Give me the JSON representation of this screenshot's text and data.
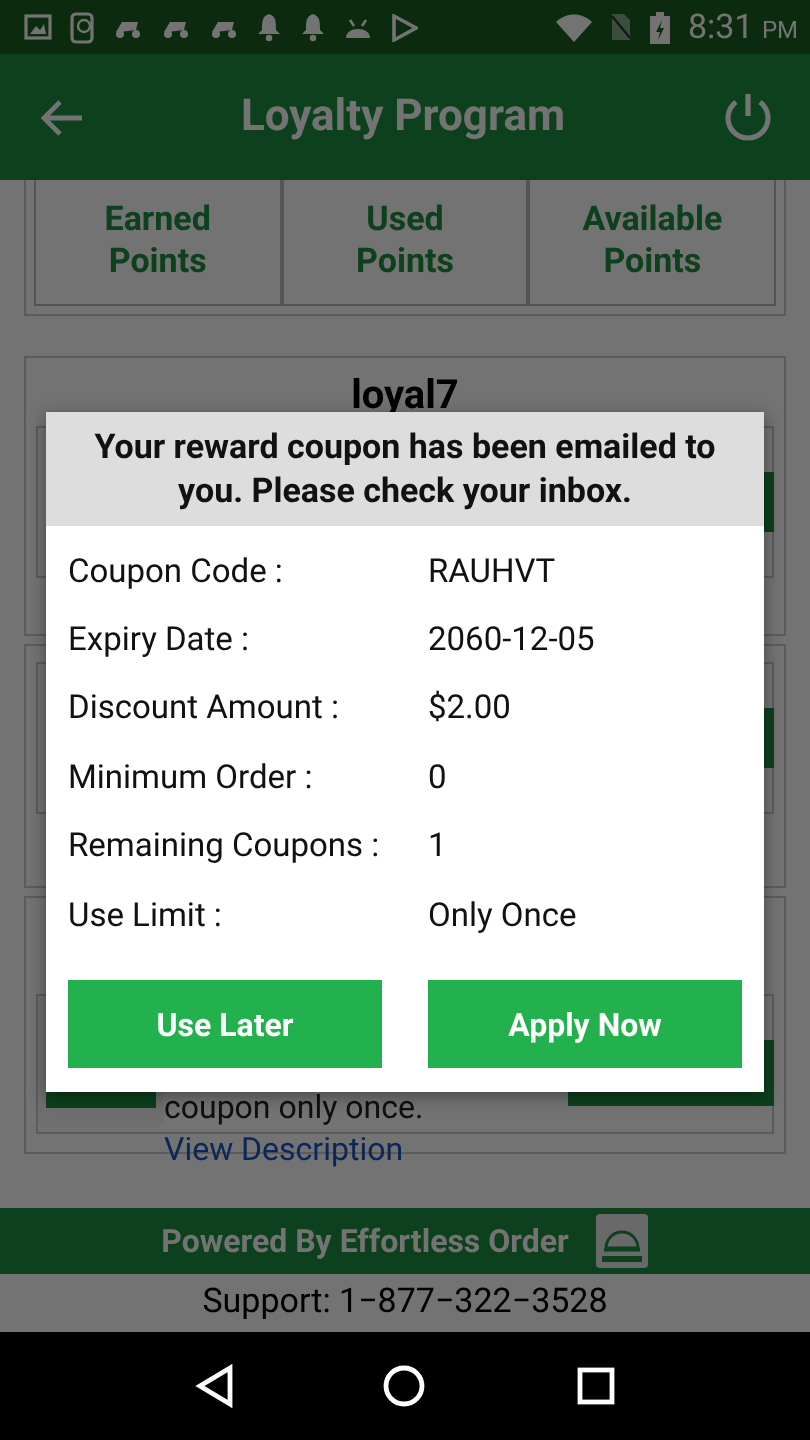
{
  "status_bar": {
    "time": "8:31",
    "ampm": "PM"
  },
  "app_bar": {
    "title": "Loyalty Program"
  },
  "points": [
    {
      "label": "Earned\nPoints"
    },
    {
      "label": "Used\nPoints"
    },
    {
      "label": "Available\nPoints"
    }
  ],
  "cards": [
    {
      "title": "loyal7"
    },
    {
      "description": "coupon only once.",
      "link": "View Description"
    }
  ],
  "footer": {
    "powered_by": "Powered By Effortless Order",
    "support": "Support: 1−877−322−3528"
  },
  "dialog": {
    "message": "Your reward coupon has been emailed to you. Please check your inbox.",
    "rows": [
      {
        "label": "Coupon Code :",
        "value": "RAUHVT"
      },
      {
        "label": "Expiry Date :",
        "value": "2060-12-05"
      },
      {
        "label": "Discount Amount :",
        "value": "$2.00"
      },
      {
        "label": "Minimum Order :",
        "value": "0"
      },
      {
        "label": "Remaining Coupons :",
        "value": "1"
      },
      {
        "label": "Use Limit :",
        "value": "Only Once"
      }
    ],
    "buttons": [
      {
        "label": "Use Later"
      },
      {
        "label": "Apply Now"
      }
    ]
  }
}
